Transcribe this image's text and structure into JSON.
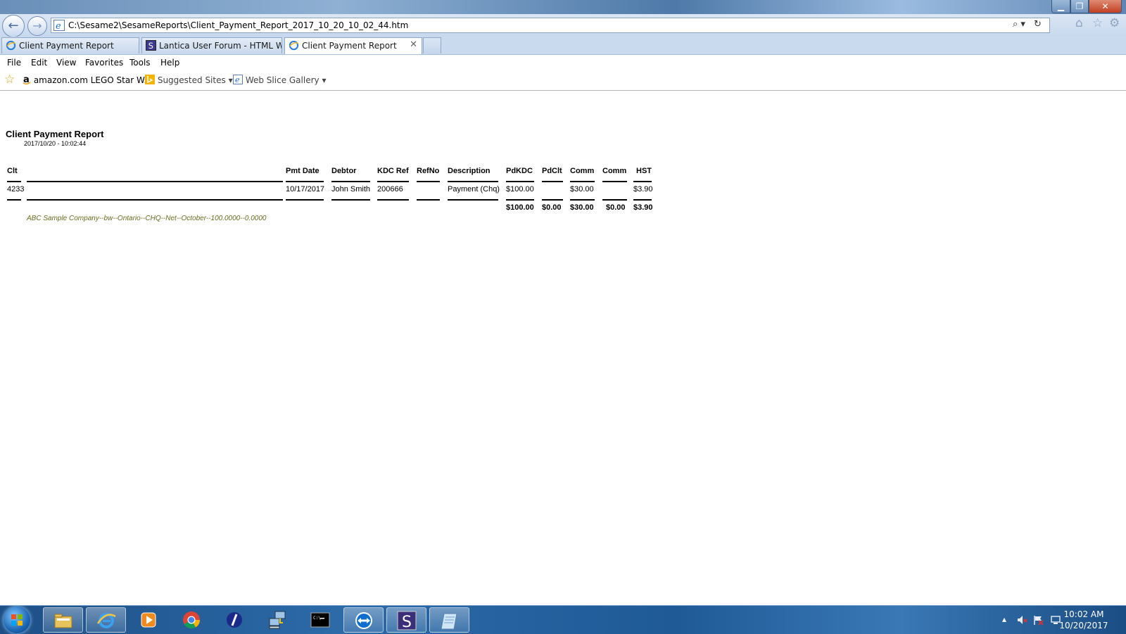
{
  "window": {
    "title_bar_text": "",
    "minimize_label": "▁",
    "restore_label": "❐",
    "close_label": "✕"
  },
  "address_bar": {
    "url": "C:\\Sesame2\\SesameReports\\Client_Payment_Report_2017_10_20_10_02_44.htm",
    "search_glyph": "⌕ ▾",
    "refresh_glyph": "↻",
    "back_glyph": "←",
    "forward_glyph": "→"
  },
  "toolbar_icons": {
    "home": "⌂",
    "favorites": "☆",
    "settings": "⚙"
  },
  "tabs": [
    {
      "label": "Client Payment Report",
      "icon": "ie-page-icon",
      "active": false
    },
    {
      "label": "Lantica User Forum - HTML Wi...",
      "icon": "sesame-icon",
      "active": false
    },
    {
      "label": "Client Payment Report",
      "icon": "ie-page-icon",
      "active": true
    }
  ],
  "tab_close_glyph": "✕",
  "menu": [
    "File",
    "Edit",
    "View",
    "Favorites",
    "Tools",
    "Help"
  ],
  "favorites_bar": {
    "star_icon": "☆",
    "items": [
      {
        "label": "amazon.com LEGO Star W...",
        "icon": "amazon-icon",
        "dropdown": ""
      },
      {
        "label": "Suggested Sites",
        "icon": "bing-icon",
        "dropdown": "▾"
      },
      {
        "label": "Web Slice Gallery",
        "icon": "ie-page-icon",
        "dropdown": "▾"
      }
    ]
  },
  "report": {
    "title": "Client Payment Report",
    "timestamp": "2017/10/20 - 10:02:44",
    "columns": [
      "Clt",
      "Pmt Date",
      "Debtor",
      "KDC Ref",
      "RefNo",
      "Description",
      "PdKDC",
      "PdClt",
      "Comm",
      "Comm",
      "HST"
    ],
    "rows": [
      [
        "4233",
        "10/17/2017",
        "John Smith",
        "200666",
        "",
        "Payment (Chq)",
        "$100.00",
        "",
        "$30.00",
        "",
        "$3.90"
      ]
    ],
    "totals": {
      "PdKDC": "$100.00",
      "PdClt": "$0.00",
      "Comm1": "$30.00",
      "Comm2": "$0.00",
      "HST": "$3.90"
    },
    "footnote": "ABC Sample Company--bw--Ontario--CHQ--Net--October--100.0000--0.0000"
  },
  "taskbar": {
    "apps": [
      {
        "name": "windows-explorer",
        "active": false
      },
      {
        "name": "internet-explorer",
        "active": true
      },
      {
        "name": "media-player",
        "active": false
      },
      {
        "name": "chrome",
        "active": false
      },
      {
        "name": "app-slash",
        "active": false
      },
      {
        "name": "network-app",
        "active": false
      },
      {
        "name": "command-prompt",
        "active": false
      },
      {
        "name": "teamviewer",
        "active": false
      },
      {
        "name": "sesame",
        "active": true
      },
      {
        "name": "notepad",
        "active": true
      }
    ],
    "tray": {
      "expand_glyph": "▴",
      "clock_time": "10:02 AM",
      "clock_date": "10/20/2017"
    }
  },
  "colors": {
    "footnote": "#6b6b1f",
    "taskbar": "#1f5a96",
    "titlebar": "#6a8fb8"
  }
}
